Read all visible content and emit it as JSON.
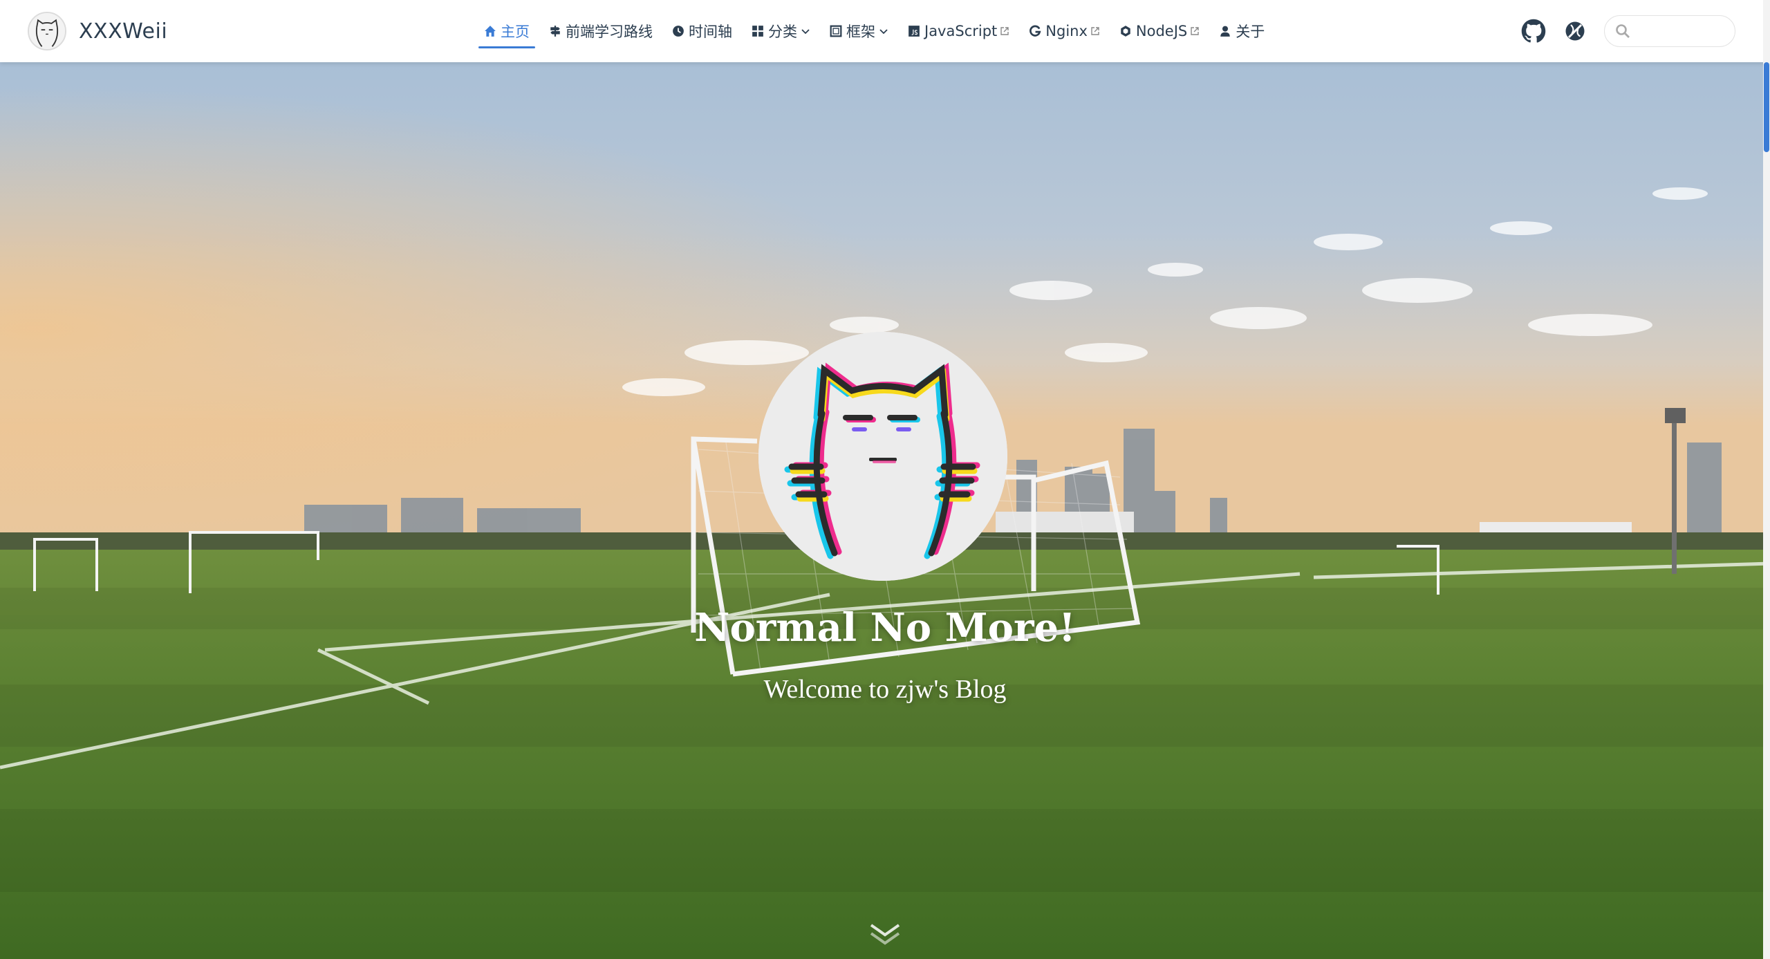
{
  "brand": {
    "name": "XXXWeii",
    "avatar_icon": "cat-avatar-icon"
  },
  "nav": {
    "items": [
      {
        "label": "主页",
        "icon": "home-icon",
        "active": true
      },
      {
        "label": "前端学习路线",
        "icon": "signpost-icon"
      },
      {
        "label": "时间轴",
        "icon": "clock-icon"
      },
      {
        "label": "分类",
        "icon": "grid-icon",
        "dropdown": true
      },
      {
        "label": "框架",
        "icon": "frame-icon",
        "dropdown": true
      },
      {
        "label": "JavaScript",
        "icon": "js-icon",
        "external": true
      },
      {
        "label": "Nginx",
        "icon": "g-icon",
        "external": true
      },
      {
        "label": "NodeJS",
        "icon": "hexagon-icon",
        "external": true
      },
      {
        "label": "关于",
        "icon": "user-icon"
      }
    ],
    "accent_color": "#3a7bd5",
    "text_color": "#2c3e50"
  },
  "toolbar": {
    "github_icon": "github-icon",
    "theme_icon": "theme-icon",
    "search": {
      "placeholder": "",
      "value": "",
      "icon": "search-icon"
    }
  },
  "hero": {
    "title": "Normal No More!",
    "subtitle": "Welcome to zjw's Blog",
    "background": "soccer-field-sunset",
    "scroll_icon": "chevron-down-icon"
  }
}
